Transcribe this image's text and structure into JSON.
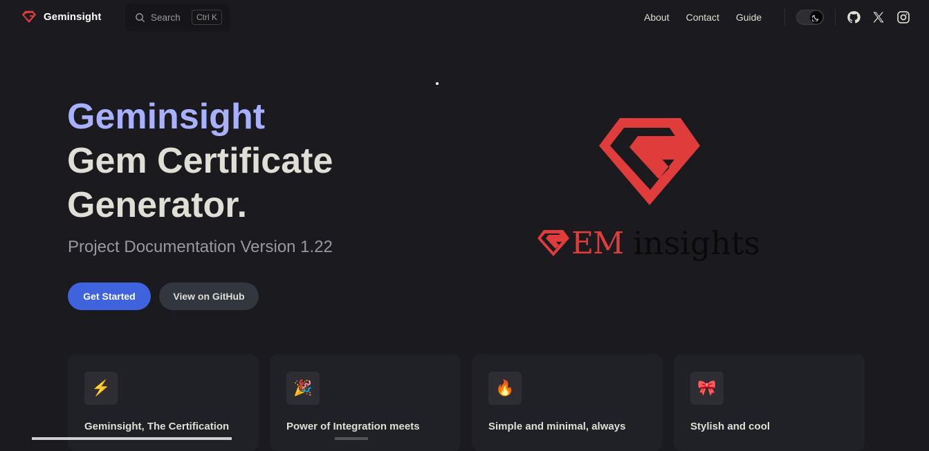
{
  "nav": {
    "brand": "Geminsight",
    "search_label": "Search",
    "search_shortcut": "Ctrl K",
    "links": [
      "About",
      "Contact",
      "Guide"
    ],
    "icons": [
      "moon-icon",
      "github-icon",
      "x-icon",
      "instagram-icon"
    ]
  },
  "hero": {
    "name": "Geminsight",
    "text_line1": "Gem Certificate",
    "text_line2": "Generator.",
    "tagline": "Project Documentation Version 1.22",
    "actions": [
      {
        "label": "Get Started",
        "theme": "brand"
      },
      {
        "label": "View on GitHub",
        "theme": "alt"
      }
    ],
    "image": {
      "wordmark_em": "EM",
      "wordmark_insights": "insights"
    }
  },
  "features": [
    {
      "icon": "⚡",
      "title": "Geminsight, The Certification"
    },
    {
      "icon": "🎉",
      "title": "Power of Integration meets"
    },
    {
      "icon": "🔥",
      "title": "Simple and minimal, always"
    },
    {
      "icon": "🎀",
      "title": "Stylish and cool"
    }
  ],
  "colors": {
    "background": "#1b1b1f",
    "brand_name": "#a8b1ff",
    "primary_button": "#3e63dd",
    "logo_red": "#e03c3c"
  }
}
